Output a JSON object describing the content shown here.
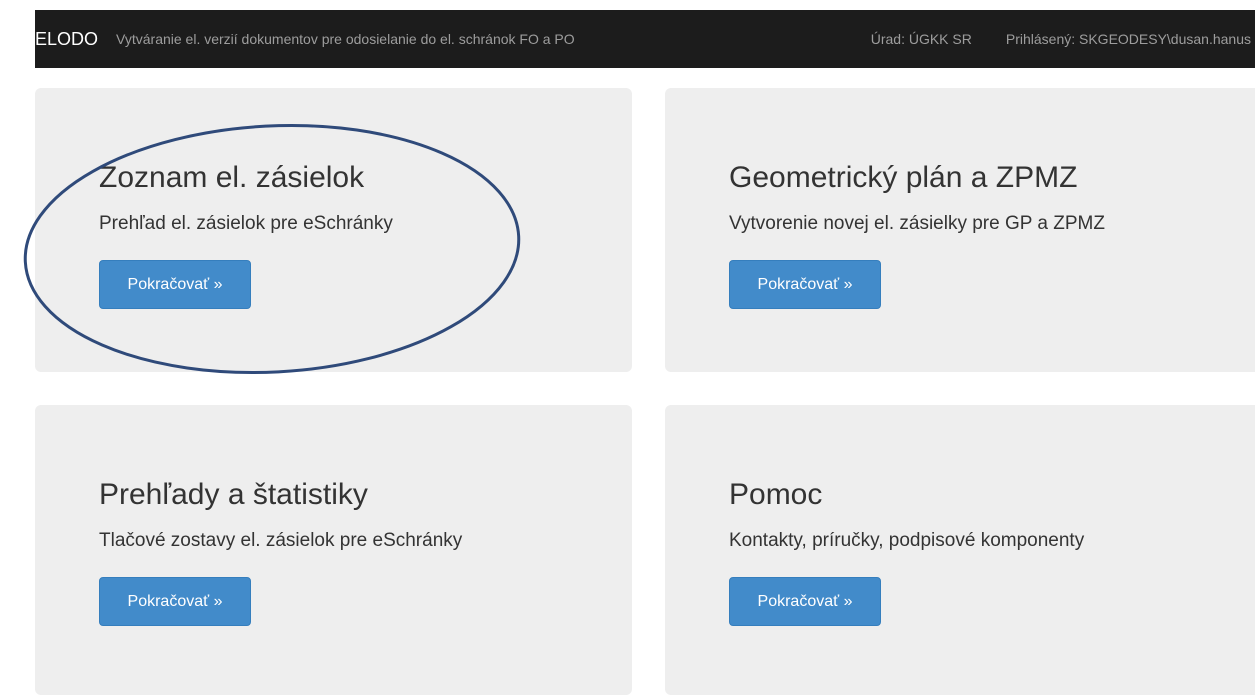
{
  "navbar": {
    "brand": "ELODO",
    "subtitle": "Vytváranie el. verzií dokumentov pre odosielanie do el. schránok FO a PO",
    "office": "Úrad: ÚGKK SR",
    "user": "Prihlásený: SKGEODESY\\dusan.hanus"
  },
  "panels": [
    {
      "title": "Zoznam el. zásielok",
      "description": "Prehľad el. zásielok pre eSchránky",
      "button": "Pokračovať »"
    },
    {
      "title": "Geometrický plán a ZPMZ",
      "description": "Vytvorenie novej el. zásielky pre GP a ZPMZ",
      "button": "Pokračovať »"
    },
    {
      "title": "Prehľady a štatistiky",
      "description": "Tlačové zostavy el. zásielok pre eSchránky",
      "button": "Pokračovať »"
    },
    {
      "title": "Pomoc",
      "description": "Kontakty, príručky, podpisové komponenty",
      "button": "Pokračovať »"
    }
  ],
  "colors": {
    "navbar_bg": "#1c1c1c",
    "panel_bg": "#eeeeee",
    "button_bg": "#428bca",
    "annotation": "#2f4a7a"
  }
}
